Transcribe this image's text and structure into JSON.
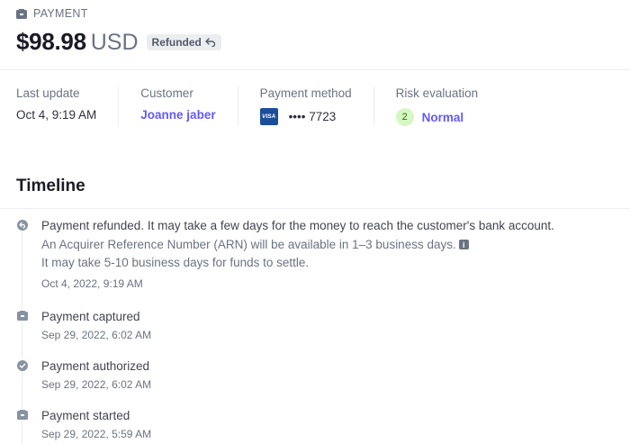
{
  "header": {
    "eyebrow": "PAYMENT",
    "amount": "$98.98",
    "currency": "USD",
    "status_badge": "Refunded"
  },
  "summary": {
    "last_update": {
      "label": "Last update",
      "value": "Oct 4, 9:19 AM"
    },
    "customer": {
      "label": "Customer",
      "value": "Joanne jaber"
    },
    "payment_method": {
      "label": "Payment method",
      "brand": "VISA",
      "last4": "•••• 7723"
    },
    "risk": {
      "label": "Risk evaluation",
      "score": "2",
      "value": "Normal"
    }
  },
  "timeline": {
    "title": "Timeline",
    "events": [
      {
        "icon": "refund-icon",
        "text": "Payment refunded. It may take a few days for the money to reach the customer's bank account.",
        "sub1": "An Acquirer Reference Number (ARN) will be available in 1–3 business days.",
        "sub2": "It may take 5-10 business days for funds to settle.",
        "date": "Oct 4, 2022, 9:19 AM"
      },
      {
        "icon": "captured-icon",
        "text": "Payment captured",
        "date": "Sep 29, 2022, 6:02 AM"
      },
      {
        "icon": "check-circle-icon",
        "text": "Payment authorized",
        "date": "Sep 29, 2022, 6:02 AM"
      },
      {
        "icon": "payment-started-icon",
        "text": "Payment started",
        "date": "Sep 29, 2022, 5:59 AM"
      }
    ]
  },
  "colors": {
    "accent": "#625afa",
    "risk_bg": "#d7f7c2",
    "risk_text": "#217005",
    "visa_blue": "#1a4e9a"
  }
}
